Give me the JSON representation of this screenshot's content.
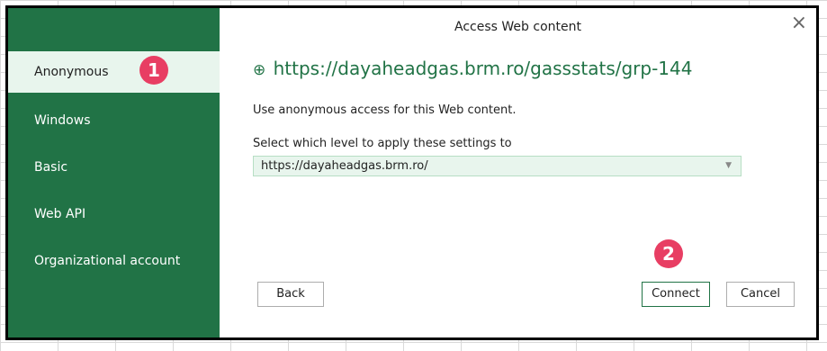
{
  "dialog": {
    "title": "Access Web content",
    "close_glyph": "×",
    "url": "https://dayaheadgas.brm.ro/gassstats/grp-144",
    "globe_glyph": "⊕",
    "description": "Use anonymous access for this Web content.",
    "level_label": "Select which level to apply these settings to",
    "level_value": "https://dayaheadgas.brm.ro/",
    "level_arrow": "▼",
    "back_label": "Back",
    "connect_label": "Connect",
    "cancel_label": "Cancel"
  },
  "sidebar": {
    "items": [
      {
        "label": "Anonymous",
        "selected": true
      },
      {
        "label": "Windows"
      },
      {
        "label": "Basic"
      },
      {
        "label": "Web API"
      },
      {
        "label": "Organizational account"
      }
    ]
  },
  "annotations": {
    "badge1": "1",
    "badge2": "2"
  },
  "colors": {
    "accent": "#217346",
    "selected_bg": "#e8f5ed",
    "badge": "#e83e63"
  }
}
